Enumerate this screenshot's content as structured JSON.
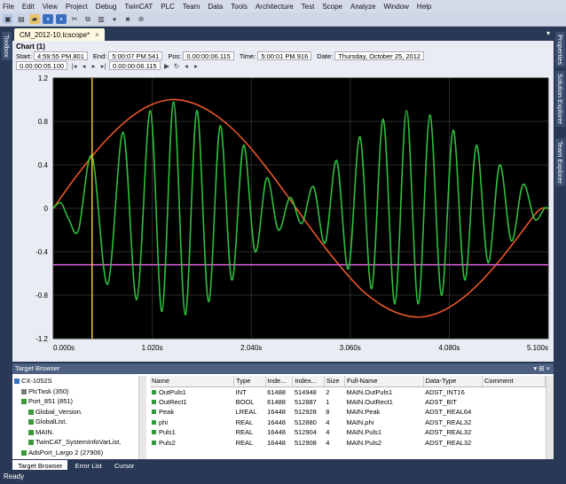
{
  "menu": [
    "File",
    "Edit",
    "View",
    "Project",
    "Debug",
    "TwinCAT",
    "PLC",
    "Team",
    "Data",
    "Tools",
    "Architecture",
    "Test",
    "Scope",
    "Analyze",
    "Window",
    "Help"
  ],
  "left_sidebar": {
    "toolbox": "Toolbox"
  },
  "right_sidebar": {
    "properties": "Properties",
    "solution_explorer": "Solution Explorer",
    "team_explorer": "Team Explorer"
  },
  "document_tab": {
    "title": "CM_2012-10.tcscope*",
    "close": "×"
  },
  "chart": {
    "title": "Chart (1)",
    "start_label": "Start:",
    "start": "4:59:55 PM.801",
    "end_label": "End:",
    "end": "5:00:07 PM.541",
    "pos_label": "Pos:",
    "pos": "0.00:00:06.115",
    "time_label": "Time:",
    "time": "5:00:01 PM.916",
    "date_label": "Date:",
    "date": "Thursday, October 25, 2012",
    "span_value": "0.00:00:05.100",
    "pos_value": "0.00:00:06.115"
  },
  "chart_data": {
    "type": "line",
    "background": "#000000",
    "grid": true,
    "xlim": [
      0,
      5.1
    ],
    "ylim": [
      -1.2,
      1.2
    ],
    "yticks": [
      "1.2",
      "0.8",
      "0.4",
      "0",
      "-0.4",
      "-0.8",
      "-1.2"
    ],
    "xticks": [
      "0.000s",
      "1.020s",
      "2.040s",
      "3.060s",
      "4.080s",
      "5.100s"
    ],
    "cursor_x": 0.4,
    "series": [
      {
        "color": "#e8562a",
        "x": [
          0,
          0.2,
          0.4,
          0.6,
          0.8,
          1.0,
          1.2,
          1.4,
          1.6,
          1.8,
          2.0,
          2.2,
          2.4,
          2.6,
          2.8,
          3.0,
          3.2,
          3.4,
          3.6,
          3.8,
          4.0,
          4.2,
          4.4,
          4.6,
          4.8,
          5.0,
          5.1
        ],
        "y": [
          0,
          0.25,
          0.48,
          0.68,
          0.84,
          0.95,
          1.0,
          0.98,
          0.9,
          0.77,
          0.59,
          0.37,
          0.13,
          -0.12,
          -0.36,
          -0.58,
          -0.77,
          -0.9,
          -0.98,
          -1.0,
          -0.95,
          -0.84,
          -0.68,
          -0.48,
          -0.25,
          -0.02,
          0
        ]
      },
      {
        "color": "#d65ad1",
        "x": [
          0,
          5.1
        ],
        "y": [
          -0.52,
          -0.52
        ]
      },
      {
        "color": "#2fbf3d",
        "x": [
          0,
          0.08,
          0.16,
          0.26,
          0.4,
          0.56,
          0.72,
          0.86,
          1.0,
          1.12,
          1.24,
          1.36,
          1.48,
          1.6,
          1.72,
          1.84,
          1.96,
          2.08,
          2.2,
          2.32,
          2.44,
          2.56,
          2.68,
          2.8,
          2.92,
          3.04,
          3.16,
          3.28,
          3.4,
          3.52,
          3.64,
          3.76,
          3.88,
          4.0,
          4.12,
          4.24,
          4.36,
          4.48,
          4.6,
          4.72,
          4.84,
          4.96,
          5.06,
          5.1
        ],
        "y": [
          0,
          0.05,
          -0.1,
          -0.2,
          0.48,
          -0.7,
          0.7,
          -0.84,
          0.9,
          -0.95,
          0.98,
          -0.98,
          0.9,
          -0.86,
          0.76,
          -0.66,
          0.58,
          -0.4,
          0.28,
          -0.2,
          0.1,
          -0.14,
          0.2,
          -0.32,
          0.44,
          -0.56,
          0.66,
          -0.74,
          0.82,
          -0.88,
          0.9,
          -0.88,
          0.86,
          -0.8,
          0.72,
          -0.66,
          0.58,
          -0.5,
          0.4,
          -0.3,
          0.22,
          -0.1,
          0,
          0
        ]
      }
    ]
  },
  "target_browser": {
    "title": "Target Browser",
    "tree": [
      {
        "label": "CX-1052S",
        "color": "#3a6ec0"
      },
      {
        "label": "PlcTask (350)",
        "color": "#7a7a7a"
      },
      {
        "label": "Port_851 (851)",
        "color": "#3a9a3a"
      },
      {
        "label": "Global_Version.",
        "color": "#3a9a3a"
      },
      {
        "label": "GlobalList.",
        "color": "#3a9a3a"
      },
      {
        "label": "MAIN.",
        "color": "#3a9a3a"
      },
      {
        "label": "TwinCAT_SystemInfoVarList.",
        "color": "#3a9a3a"
      },
      {
        "label": "AdsPort_Largo 2 (27906)",
        "color": "#3a9a3a"
      }
    ],
    "columns": [
      "Name",
      "Type",
      "Inde...",
      "Index...",
      "Size",
      "Full-Name",
      "Data-Type",
      "Comment"
    ],
    "rows": [
      [
        "OutPuls1",
        "INT",
        "61488",
        "514948",
        "2",
        "MAIN.OutPuls1",
        "ADST_INT16",
        ""
      ],
      [
        "OutRect1",
        "BOOL",
        "61488",
        "512887",
        "1",
        "MAIN.OutRect1",
        "ADST_BIT",
        ""
      ],
      [
        "Peak",
        "LREAL",
        "16448",
        "512928",
        "8",
        "MAIN.Peak",
        "ADST_REAL64",
        ""
      ],
      [
        "phi",
        "REAL",
        "16448",
        "512880",
        "4",
        "MAIN.phi",
        "ADST_REAL32",
        ""
      ],
      [
        "Puls1",
        "REAL",
        "16448",
        "512904",
        "4",
        "MAIN.Puls1",
        "ADST_REAL32",
        ""
      ],
      [
        "Puls2",
        "REAL",
        "16448",
        "512908",
        "4",
        "MAIN.Puls2",
        "ADST_REAL32",
        ""
      ]
    ]
  },
  "bottom_tabs": [
    "Target Browser",
    "Error List",
    "Cursor"
  ],
  "status": "Ready"
}
